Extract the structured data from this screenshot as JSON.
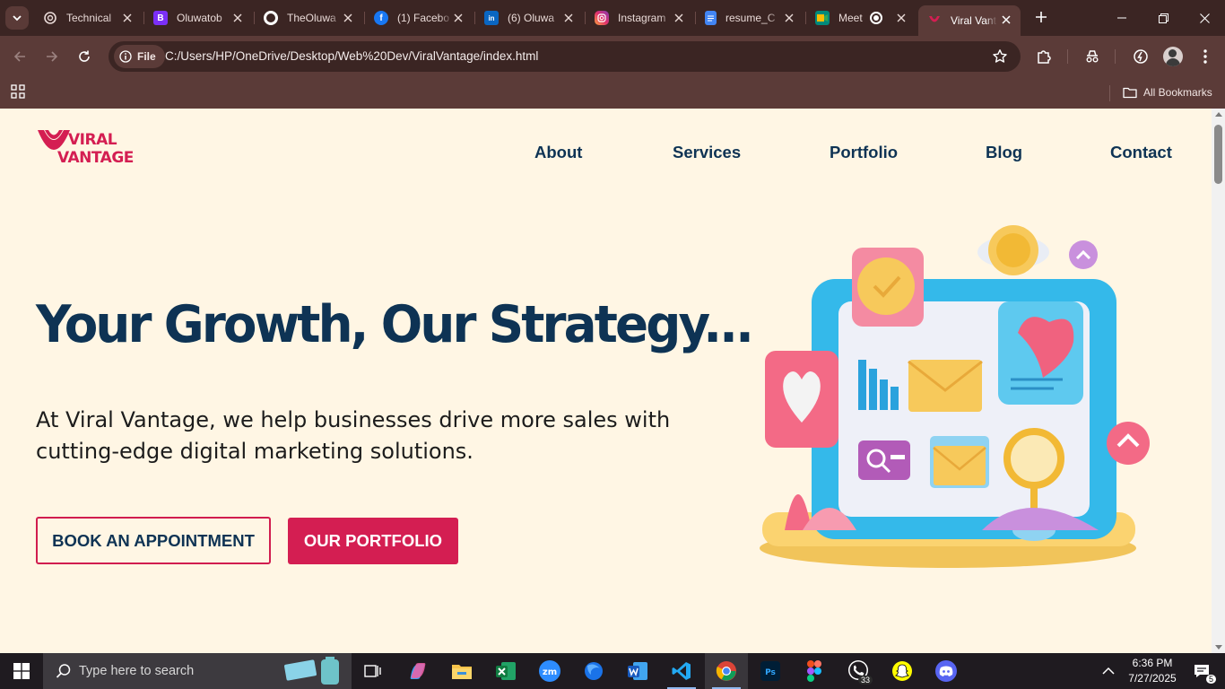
{
  "browser": {
    "tabs": [
      {
        "label": "Technical",
        "icon": "openai-icon",
        "color": "#3b2523"
      },
      {
        "label": "Oluwatob",
        "icon": "bootstrap-icon",
        "color": "#7b2ff7"
      },
      {
        "label": "TheOluwa",
        "icon": "github-icon",
        "color": "#ffffff"
      },
      {
        "label": "(1) Facebo",
        "icon": "facebook-icon",
        "color": "#1877f2"
      },
      {
        "label": "(6) Oluwa",
        "icon": "linkedin-icon",
        "color": "#0a66c2"
      },
      {
        "label": "Instagram",
        "icon": "instagram-icon",
        "color": "#e1306c"
      },
      {
        "label": "resume_C",
        "icon": "google-docs-icon",
        "color": "#4285f4"
      },
      {
        "label": "Meet",
        "icon": "google-meet-icon",
        "color": "#00897b"
      },
      {
        "label": "Viral Vanta",
        "icon": "viral-vantage-icon",
        "color": "#d41e52"
      }
    ],
    "address": {
      "chip": "File",
      "url": "C:/Users/HP/OneDrive/Desktop/Web%20Dev/ViralVantage/index.html"
    },
    "bookmarks": {
      "all_label": "All Bookmarks"
    }
  },
  "page": {
    "logo": {
      "line1": "VIRAL",
      "line2": "VANTAGE"
    },
    "nav": [
      "About",
      "Services",
      "Portfolio",
      "Blog",
      "Contact"
    ],
    "hero": {
      "title": "Your Growth, Our Strategy...",
      "subtitle": "At Viral Vantage, we help businesses drive more sales with cutting-edge digital marketing solutions."
    },
    "buttons": {
      "appointment": "BOOK AN APPOINTMENT",
      "portfolio": "OUR PORTFOLIO"
    },
    "colors": {
      "primary": "#0e3354",
      "accent": "#d41e52",
      "background": "#fff6e4"
    }
  },
  "taskbar": {
    "search_placeholder": "Type here to search",
    "time": "6:36 PM",
    "date": "7/27/2025",
    "whatsapp_badge": "33",
    "notification_count": "5"
  }
}
